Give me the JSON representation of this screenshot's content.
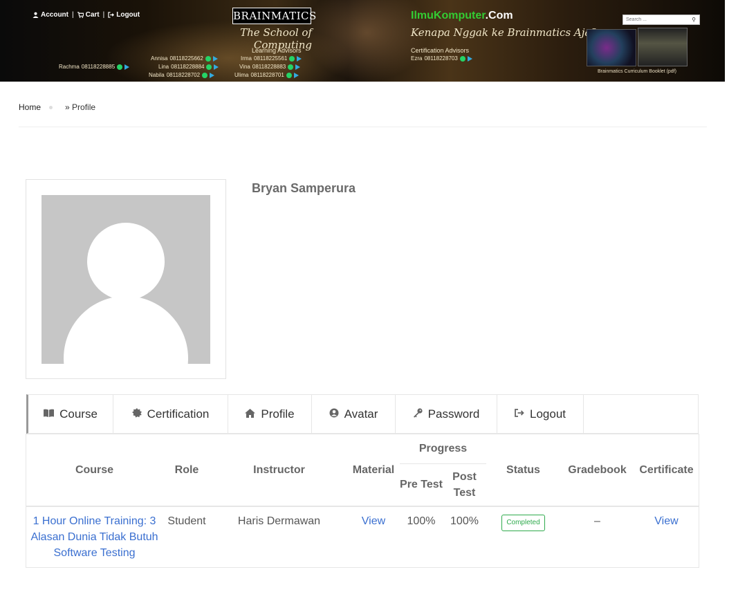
{
  "header": {
    "nav": {
      "account": "Account",
      "cart": "Cart",
      "logout": "Logout",
      "separator": "|"
    },
    "brand": "BRAINMATICS",
    "tagline": "The School of Computing",
    "learning_advisors_title": "Learning Advisors",
    "learning_advisors": [
      {
        "name": "Rachma",
        "phone": "08118228885"
      },
      {
        "name": "Annisa",
        "phone": "08118225662"
      },
      {
        "name": "Irma",
        "phone": "08118225561"
      },
      {
        "name": "Lina",
        "phone": "08118228884"
      },
      {
        "name": "Vina",
        "phone": "08118228883"
      },
      {
        "name": "Nabila",
        "phone": "08118228702"
      },
      {
        "name": "Ulima",
        "phone": "08118228701"
      }
    ],
    "ilmukomputer_green": "IlmuKomputer",
    "ilmukomputer_white": ".Com",
    "tagline2": "Kenapa Nggak ke Brainmatics Aja?",
    "certification_advisors_title": "Certification Advisors",
    "certification_advisor": {
      "name": "Ezra",
      "phone": "08118228703"
    },
    "search_placeholder": "Search ...",
    "booklet_caption": "Brainmatics Curriculum Booklet (pdf)"
  },
  "breadcrumb": {
    "home": "Home",
    "current": "» Profile"
  },
  "profile": {
    "name": "Bryan Samperura"
  },
  "tabs": [
    {
      "label": "Course",
      "icon": "book-icon"
    },
    {
      "label": "Certification",
      "icon": "certificate-icon"
    },
    {
      "label": "Profile",
      "icon": "home-icon"
    },
    {
      "label": "Avatar",
      "icon": "user-circle-icon"
    },
    {
      "label": "Password",
      "icon": "key-icon"
    },
    {
      "label": "Logout",
      "icon": "sign-out-icon"
    }
  ],
  "table": {
    "headers": {
      "course": "Course",
      "role": "Role",
      "instructor": "Instructor",
      "material": "Material",
      "progress": "Progress",
      "pre_test": "Pre Test",
      "post_test": "Post Test",
      "status": "Status",
      "gradebook": "Gradebook",
      "certificate": "Certificate"
    },
    "rows": [
      {
        "course": "1 Hour Online Training: 3 Alasan Dunia Tidak Butuh Software Testing",
        "role": "Student",
        "instructor": "Haris Dermawan",
        "material": "View",
        "pre_test": "100%",
        "post_test": "100%",
        "status": "Completed",
        "gradebook": "–",
        "certificate": "View"
      }
    ]
  },
  "colors": {
    "link": "#3a6fd0",
    "status_completed": "#2eaa4c",
    "whatsapp": "#25d366",
    "telegram": "#34aadf"
  }
}
